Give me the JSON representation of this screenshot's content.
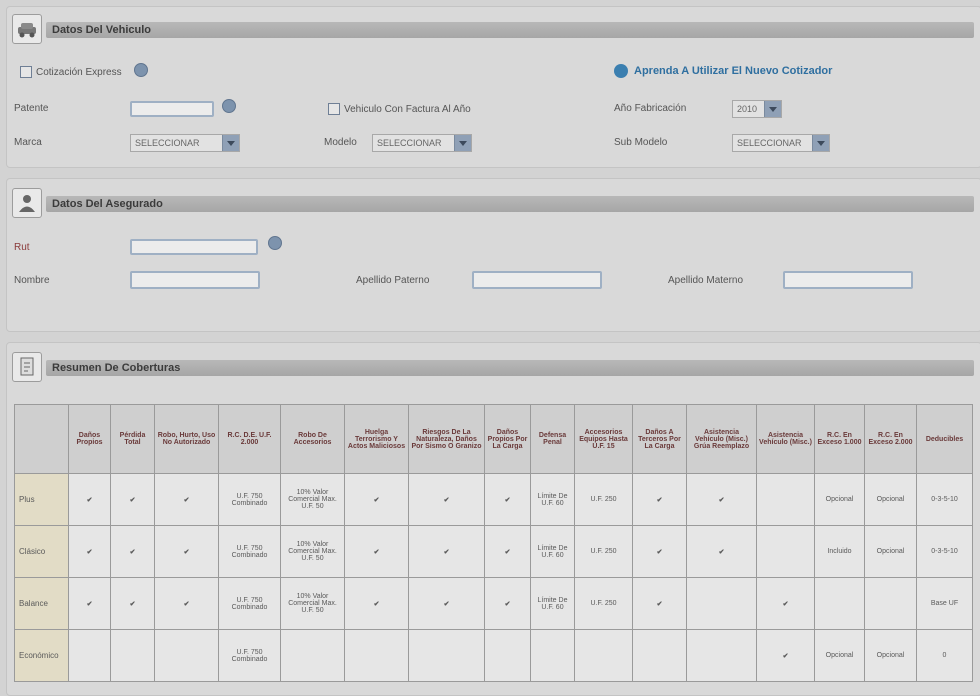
{
  "vehicle": {
    "title": "Datos Del Vehiculo",
    "checkbox_label": "Cotización Express",
    "help_link": "Aprenda A Utilizar El Nuevo Cotizador",
    "patente_label": "Patente",
    "patente_value": "",
    "marca_label": "Marca",
    "marca_value": "SELECCIONAR",
    "permiso_checkbox_label": "Vehiculo Con Factura Al Año",
    "modelo_label": "Modelo",
    "modelo_value": "SELECCIONAR",
    "anio_label": "Año Fabricación",
    "anio_value": "2010",
    "submodelo_label": "Sub Modelo",
    "submodelo_value": "SELECCIONAR"
  },
  "insured": {
    "title": "Datos Del Asegurado",
    "rut_label": "Rut",
    "nombre_label": "Nombre",
    "apellido_paterno_label": "Apellido Paterno",
    "apellido_materno_label": "Apellido Materno"
  },
  "coverage": {
    "title": "Resumen De Coberturas",
    "headers": [
      "",
      "Daños Propios",
      "Pérdida Total",
      "Robo, Hurto, Uso No Autorizado",
      "R.C. D.E. U.F. 2.000",
      "Robo De Accesorios",
      "Huelga Terrorismo Y Actos Maliciosos",
      "Riesgos De La Naturaleza, Daños Por Sismo O Granizo",
      "Daños Propios Por La Carga",
      "Defensa Penal",
      "Accesorios Equipos Hasta U.F. 15",
      "Daños A Terceros Por La Carga",
      "Asistencia Vehículo (Misc.) Grúa Reemplazo",
      "Asistencia Vehículo (Misc.)",
      "R.C. En Exceso 1.000",
      "R.C. En Exceso 2.000",
      "Deducibles"
    ],
    "rows": [
      {
        "name": "Plus",
        "cells": [
          "✔",
          "✔",
          "✔",
          "U.F. 750 Combinado",
          "10% Valor Comercial Max. U.F. 50",
          "✔",
          "✔",
          "✔",
          "Límite De U.F. 60",
          "U.F. 250",
          "✔",
          "✔",
          "",
          "Opcional",
          "Opcional",
          "0-3-5-10"
        ]
      },
      {
        "name": "Clásico",
        "cells": [
          "✔",
          "✔",
          "✔",
          "U.F. 750 Combinado",
          "10% Valor Comercial Max. U.F. 50",
          "✔",
          "✔",
          "✔",
          "Límite De U.F. 60",
          "U.F. 250",
          "✔",
          "✔",
          "",
          "Incluido",
          "Opcional",
          "0-3-5-10"
        ]
      },
      {
        "name": "Balance",
        "cells": [
          "✔",
          "✔",
          "✔",
          "U.F. 750 Combinado",
          "10% Valor Comercial Max. U.F. 50",
          "✔",
          "✔",
          "✔",
          "Límite De U.F. 60",
          "U.F. 250",
          "✔",
          "",
          "✔",
          "",
          "",
          "Base UF"
        ]
      },
      {
        "name": "Económico",
        "cells": [
          "",
          "",
          "",
          "U.F. 750 Combinado",
          "",
          "",
          "",
          "",
          "",
          "",
          "",
          "",
          "✔",
          "Opcional",
          "Opcional",
          "0"
        ]
      }
    ]
  }
}
